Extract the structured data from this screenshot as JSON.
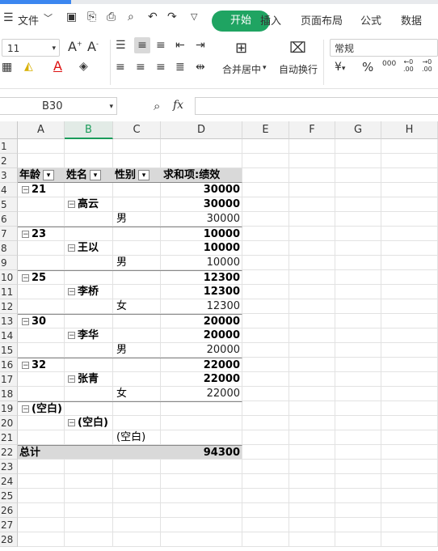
{
  "menu": {
    "file_label": "文件",
    "tabs": [
      "开始",
      "插入",
      "页面布局",
      "公式",
      "数据"
    ]
  },
  "ribbon": {
    "font_size": "11",
    "number_format": "常规",
    "merge_label": "合并居中",
    "wrap_label": "自动换行",
    "percent": "%",
    "thousands": "000",
    "currency": "¥",
    "font_grow": "A",
    "font_shrink": "A",
    "font_color_glyph": "A"
  },
  "formula_bar": {
    "cell_ref": "B30",
    "fx": "fx",
    "formula": ""
  },
  "grid": {
    "columns": [
      "A",
      "B",
      "C",
      "D",
      "E",
      "F",
      "G",
      "H"
    ],
    "selected_column": "B",
    "row_numbers": [
      "1",
      "2",
      "3",
      "4",
      "5",
      "6",
      "7",
      "8",
      "9",
      "10",
      "11",
      "12",
      "13",
      "14",
      "15",
      "16",
      "17",
      "18",
      "19",
      "20",
      "21",
      "22",
      "23",
      "24",
      "25",
      "26",
      "27",
      "28"
    ]
  },
  "pivot": {
    "headers": {
      "age": "年龄",
      "name": "姓名",
      "gender": "性别",
      "sum": "求和项:绩效"
    },
    "rows": [
      {
        "row": 4,
        "level": "age",
        "label": "21",
        "value": "30000"
      },
      {
        "row": 5,
        "level": "name",
        "label": "高云",
        "value": "30000"
      },
      {
        "row": 6,
        "level": "gender",
        "label": "男",
        "value": "30000"
      },
      {
        "row": 7,
        "level": "age",
        "label": "23",
        "value": "10000"
      },
      {
        "row": 8,
        "level": "name",
        "label": "王以",
        "value": "10000"
      },
      {
        "row": 9,
        "level": "gender",
        "label": "男",
        "value": "10000"
      },
      {
        "row": 10,
        "level": "age",
        "label": "25",
        "value": "12300"
      },
      {
        "row": 11,
        "level": "name",
        "label": "李桥",
        "value": "12300"
      },
      {
        "row": 12,
        "level": "gender",
        "label": "女",
        "value": "12300"
      },
      {
        "row": 13,
        "level": "age",
        "label": "30",
        "value": "20000"
      },
      {
        "row": 14,
        "level": "name",
        "label": "李华",
        "value": "20000"
      },
      {
        "row": 15,
        "level": "gender",
        "label": "男",
        "value": "20000"
      },
      {
        "row": 16,
        "level": "age",
        "label": "32",
        "value": "22000"
      },
      {
        "row": 17,
        "level": "name",
        "label": "张青",
        "value": "22000"
      },
      {
        "row": 18,
        "level": "gender",
        "label": "女",
        "value": "22000"
      },
      {
        "row": 19,
        "level": "age",
        "label": "(空白)",
        "value": ""
      },
      {
        "row": 20,
        "level": "name",
        "label": "(空白)",
        "value": ""
      },
      {
        "row": 21,
        "level": "gender",
        "label": "(空白)",
        "value": ""
      }
    ],
    "total_label": "总计",
    "total_value": "94300"
  }
}
